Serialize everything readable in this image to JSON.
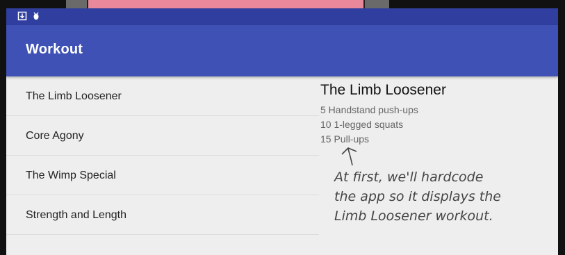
{
  "app_bar": {
    "title": "Workout"
  },
  "workouts": [
    {
      "label": "The Limb Loosener"
    },
    {
      "label": "Core Agony"
    },
    {
      "label": "The Wimp Special"
    },
    {
      "label": "Strength and Length"
    }
  ],
  "detail": {
    "title": "The Limb Loosener",
    "lines": [
      "5 Handstand push-ups",
      "10 1-legged squats",
      "15 Pull-ups"
    ]
  },
  "annotation": {
    "lines": [
      "At first, we'll hardcode",
      "the app so it displays the",
      "Limb Loosener workout."
    ]
  },
  "colors": {
    "status_bar": "#303f9f",
    "app_bar": "#3f51b5",
    "background": "#eeeeee"
  },
  "status_icons": [
    "download-icon",
    "bug-icon"
  ]
}
